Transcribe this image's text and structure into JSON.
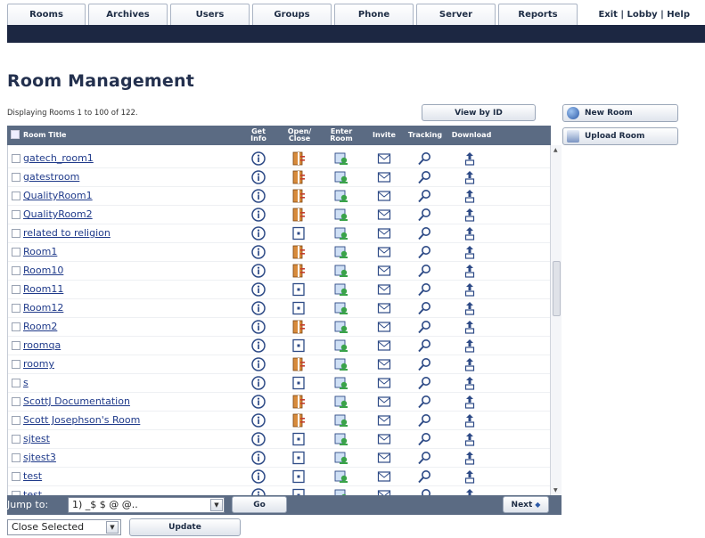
{
  "nav": {
    "tabs": [
      "Rooms",
      "Archives",
      "Users",
      "Groups",
      "Phone",
      "Server",
      "Reports"
    ],
    "links": "Exit | Lobby | Help"
  },
  "page_title": "Room Management",
  "displaying": "Displaying Rooms 1 to 100 of 122.",
  "buttons": {
    "view_by_id": "View by ID",
    "new_room": "New Room",
    "upload_room": "Upload Room",
    "go": "Go",
    "next": "Next",
    "update": "Update"
  },
  "columns": {
    "room_title": "Room Title",
    "get_info": "Get Info",
    "open_close": "Open/ Close",
    "enter_room": "Enter Room",
    "invite": "Invite",
    "tracking": "Tracking",
    "download": "Download"
  },
  "rooms": [
    {
      "name": "gatech_room1",
      "open": true
    },
    {
      "name": "gatestroom",
      "open": true
    },
    {
      "name": "QualityRoom1",
      "open": true
    },
    {
      "name": "QualityRoom2",
      "open": true
    },
    {
      "name": "related to religion",
      "open": false
    },
    {
      "name": "Room1",
      "open": true
    },
    {
      "name": "Room10",
      "open": true
    },
    {
      "name": "Room11",
      "open": false
    },
    {
      "name": "Room12",
      "open": false
    },
    {
      "name": "Room2",
      "open": true
    },
    {
      "name": "roomqa",
      "open": false
    },
    {
      "name": "roomy",
      "open": true
    },
    {
      "name": "s",
      "open": false
    },
    {
      "name": "ScottJ Documentation",
      "open": true
    },
    {
      "name": "Scott Josephson's Room",
      "open": true
    },
    {
      "name": "sjtest",
      "open": false
    },
    {
      "name": "sjtest3",
      "open": false
    },
    {
      "name": "test",
      "open": false
    },
    {
      "name": "test",
      "open": false
    }
  ],
  "footer": {
    "jump_label": "Jump to:",
    "jump_value": "1) _$ $ @ @..",
    "close_selected": "Close Selected"
  },
  "colors": {
    "header_bar": "#1c2742",
    "grid_header": "#5b6b83",
    "link": "#1f3a8a",
    "title": "#23304e"
  },
  "icons": {
    "get_info": "info-icon",
    "open_close": "door-icon",
    "enter_room": "enter-room-icon",
    "invite": "invite-icon",
    "tracking": "magnifier-icon",
    "download": "download-icon"
  }
}
